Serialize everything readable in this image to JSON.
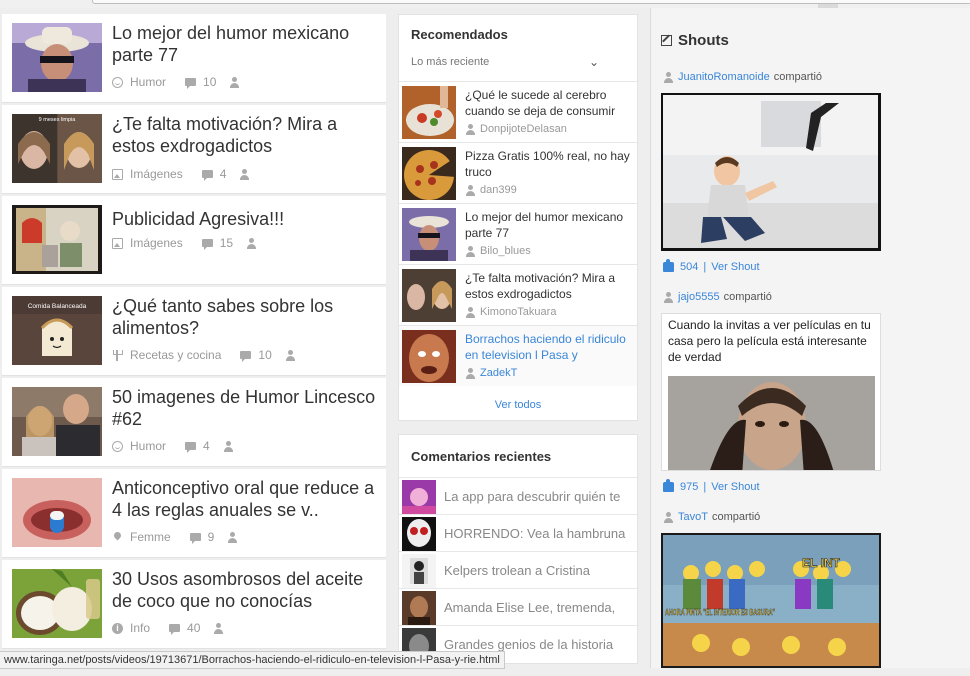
{
  "posts": [
    {
      "title": "Lo mejor del humor mexicano parte 77",
      "category": "Humor",
      "category_icon": "smile-icon",
      "comments": "10"
    },
    {
      "title": "¿Te falta motivación? Mira a estos exdrogadictos",
      "category": "Imágenes",
      "category_icon": "image-icon",
      "comments": "4",
      "thumb_caption": "9 meses limpia"
    },
    {
      "title": "Publicidad Agresiva!!!",
      "category": "Imágenes",
      "category_icon": "image-icon",
      "comments": "15"
    },
    {
      "title": "¿Qué tanto sabes sobre los alimentos?",
      "category": "Recetas y cocina",
      "category_icon": "fork-icon",
      "comments": "10",
      "thumb_caption": "Comida Balanceada"
    },
    {
      "title": "50 imagenes de Humor Lincesco #62",
      "category": "Humor",
      "category_icon": "smile-icon",
      "comments": "4"
    },
    {
      "title": "Anticonceptivo oral que reduce a 4 las reglas anuales se v..",
      "category": "Femme",
      "category_icon": "pin-icon",
      "comments": "9"
    },
    {
      "title": "30 Usos asombrosos del aceite de coco que no conocías",
      "category": "Info",
      "category_icon": "info-icon",
      "comments": "40"
    }
  ],
  "recommended": {
    "title": "Recomendados",
    "sort_label": "Lo más reciente",
    "items": [
      {
        "title": "¿Qué le sucede al cerebro cuando se deja de consumir",
        "author": "DonpijoteDelasan"
      },
      {
        "title": "Pizza Gratis 100% real, no hay truco",
        "author": "dan399"
      },
      {
        "title": "Lo mejor del humor mexicano parte 77",
        "author": "Bilo_blues"
      },
      {
        "title": "¿Te falta motivación? Mira a estos exdrogadictos",
        "author": "KimonoTakuara"
      },
      {
        "title": "Borrachos haciendo el ridiculo en television l Pasa y",
        "author": "ZadekT"
      }
    ],
    "view_all": "Ver todos"
  },
  "comments": {
    "title": "Comentarios recientes",
    "items": [
      {
        "text": "La app para descubrir quién te"
      },
      {
        "text": "HORRENDO: Vea la hambruna"
      },
      {
        "text": "Kelpers trolean a Cristina"
      },
      {
        "text": "Amanda Elise Lee, tremenda,"
      },
      {
        "text": "Grandes genios de la historia"
      }
    ]
  },
  "shouts": {
    "title": "Shouts",
    "shared_label": "compartió",
    "view_label": "Ver Shout",
    "items": [
      {
        "user": "JuanitoRomanoide",
        "likes": "504"
      },
      {
        "user": "jajo5555",
        "likes": "975",
        "text": "Cuando la invitas a ver películas en tu casa pero la película está interesante de verdad"
      },
      {
        "user": "TavoT",
        "meme_top": "EL INT",
        "meme_caption": "AHORA PINTA \"EL INTERIOR ES BASURA\""
      }
    ]
  },
  "status_url": "www.taringa.net/posts/videos/19713671/Borrachos-haciendo-el-ridiculo-en-television-l-Pasa-y-rie.html",
  "colors": {
    "link": "#3a86d8",
    "muted": "#999999",
    "background": "#eeeeee"
  }
}
